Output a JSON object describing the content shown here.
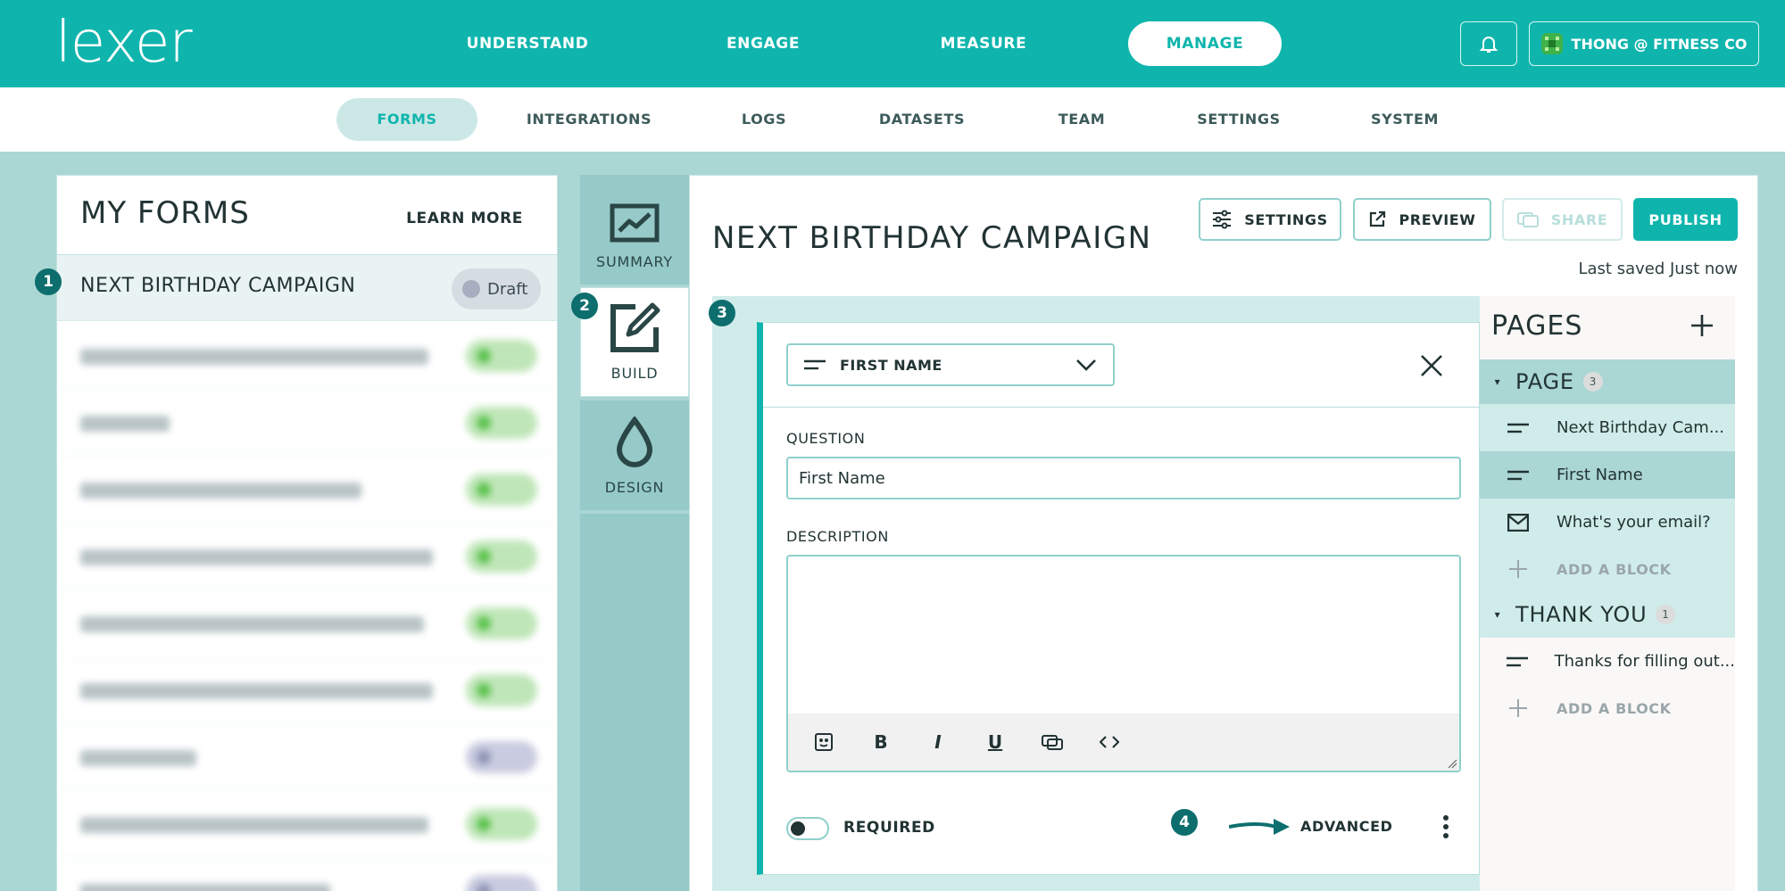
{
  "app": {
    "logo": "lexer"
  },
  "main_nav": [
    {
      "label": "UNDERSTAND",
      "active": false
    },
    {
      "label": "ENGAGE",
      "active": false
    },
    {
      "label": "MEASURE",
      "active": false
    },
    {
      "label": "MANAGE",
      "active": true
    }
  ],
  "user": {
    "name": "THONG @ FITNESS CO",
    "icons": {
      "bell": "bell-icon",
      "avatar": "pixel-avatar-icon"
    }
  },
  "sub_nav": [
    {
      "label": "FORMS",
      "active": true
    },
    {
      "label": "INTEGRATIONS",
      "active": false
    },
    {
      "label": "LOGS",
      "active": false
    },
    {
      "label": "DATASETS",
      "active": false
    },
    {
      "label": "TEAM",
      "active": false
    },
    {
      "label": "SETTINGS",
      "active": false
    },
    {
      "label": "SYSTEM",
      "active": false
    }
  ],
  "forms_panel": {
    "title": "MY FORMS",
    "learn_more": "LEARN MORE",
    "active_form": {
      "name": "NEXT BIRTHDAY CAMPAIGN",
      "status": "Draft"
    }
  },
  "side_tabs": [
    {
      "label": "SUMMARY",
      "icon": "chart-icon",
      "active": false
    },
    {
      "label": "BUILD",
      "icon": "edit-icon",
      "active": true
    },
    {
      "label": "DESIGN",
      "icon": "drop-icon",
      "active": false
    }
  ],
  "editor": {
    "title": "NEXT BIRTHDAY CAMPAIGN",
    "buttons": {
      "settings": "SETTINGS",
      "preview": "PREVIEW",
      "share": "SHARE",
      "publish": "PUBLISH"
    },
    "last_saved": "Last saved Just now",
    "block": {
      "type": "FIRST NAME",
      "question_label": "QUESTION",
      "question_value": "First Name",
      "description_label": "DESCRIPTION",
      "description_value": "",
      "toolbar": [
        "emoji-icon",
        "bold-icon",
        "italic-icon",
        "underline-icon",
        "link-icon",
        "code-icon"
      ],
      "required_label": "REQUIRED",
      "required": false,
      "advanced_label": "ADVANCED"
    }
  },
  "pages_panel": {
    "title": "PAGES",
    "sections": [
      {
        "name": "PAGE",
        "count": "3",
        "items": [
          {
            "label": "Next Birthday Cam...",
            "icon": "short-text-icon"
          },
          {
            "label": "First Name",
            "icon": "short-text-icon",
            "selected": true
          },
          {
            "label": "What's your email?",
            "icon": "email-icon"
          }
        ],
        "add": "ADD A BLOCK"
      },
      {
        "name": "THANK YOU",
        "count": "1",
        "items": [
          {
            "label": "Thanks for filling out...",
            "icon": "short-text-icon"
          }
        ],
        "add": "ADD A BLOCK"
      }
    ]
  },
  "markers": [
    "1",
    "2",
    "3",
    "4"
  ],
  "colors": {
    "brand": "#0fb5ad",
    "background": "#aad6d4",
    "marker": "#0e6e6e"
  }
}
